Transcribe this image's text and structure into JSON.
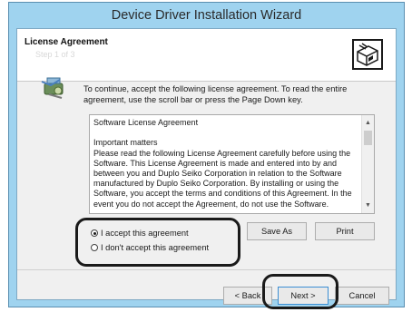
{
  "window": {
    "title": "Device Driver Installation Wizard"
  },
  "header": {
    "title": "License Agreement",
    "subtitle": "Step 1 of 3",
    "icon": "installer-box-icon"
  },
  "instruction": "To continue, accept the following license agreement. To read the entire agreement, use the scroll bar or press the Page Down key.",
  "license": {
    "text": "Software License Agreement\n\nImportant matters\nPlease read the following License Agreement carefully before using the Software. This License Agreement is made and entered into by and between you and Duplo Seiko Corporation in relation to the Software manufactured by Duplo Seiko Corporation. By installing or using the Software, you accept the terms and conditions of this Agreement. In the event you do not accept the Agreement, do not use the Software."
  },
  "options": {
    "accept": "I accept this agreement",
    "decline": "I don't accept this agreement",
    "selected": "accept"
  },
  "buttons": {
    "save_as": "Save As",
    "print": "Print",
    "back": "< Back",
    "next": "Next >",
    "cancel": "Cancel"
  }
}
